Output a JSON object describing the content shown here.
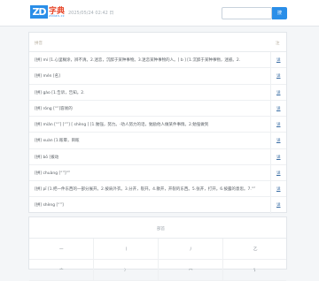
{
  "header": {
    "logo_mark": "ZD",
    "logo_cn": "字典",
    "logo_sub": "zidian.cc",
    "datetime": "2025/05/24 02:42 日",
    "search_placeholder": "",
    "search_button": "搜"
  },
  "panel": {
    "title": "拼音",
    "col_label": "注",
    "rows": [
      {
        "text": "[拼] mí [1.心里糊涂，辨不清。2.迷恋，沉醉于某种事物。3.迷恋某种事物的人。[ b ] [1.沉醉于某种事物，迷惑。2.",
        "link": "详"
      },
      {
        "text": "[拼] mén [名]",
        "link": "详"
      },
      {
        "text": "[拼] gào [1.告诉，告知。2.",
        "link": "详"
      },
      {
        "text": "[拼] róng [“”]容易的",
        "link": "详"
      },
      {
        "text": "[拼] miǎn [“”] [“”] [ shèng ] [1.勉强，努力。-劝人努力的话，勉励他人做某件事情。2.勉强做到",
        "link": "详"
      },
      {
        "text": "[拼] xuàn [1.眩晕，目眩",
        "link": "详"
      },
      {
        "text": "[拼] bō [拨动",
        "link": "详"
      },
      {
        "text": "[拼] chuàng [“”]“”",
        "link": "详"
      },
      {
        "text": "[拼] pī [1.把一件东西的一部分展开。2.披肩外衣。3.分开，裂开。4.散开，开裂的东西。5.张开，打开。6.披露的意思。7.“”",
        "link": "详"
      },
      {
        "text": "[拼] shèng [“”]",
        "link": "详"
      }
    ]
  },
  "bottom_panel": {
    "title": "部首",
    "rows": [
      [
        "一",
        "丨",
        "丿",
        "乙"
      ],
      [
        "亠",
        "冫",
        "冖",
        "讠"
      ]
    ]
  }
}
